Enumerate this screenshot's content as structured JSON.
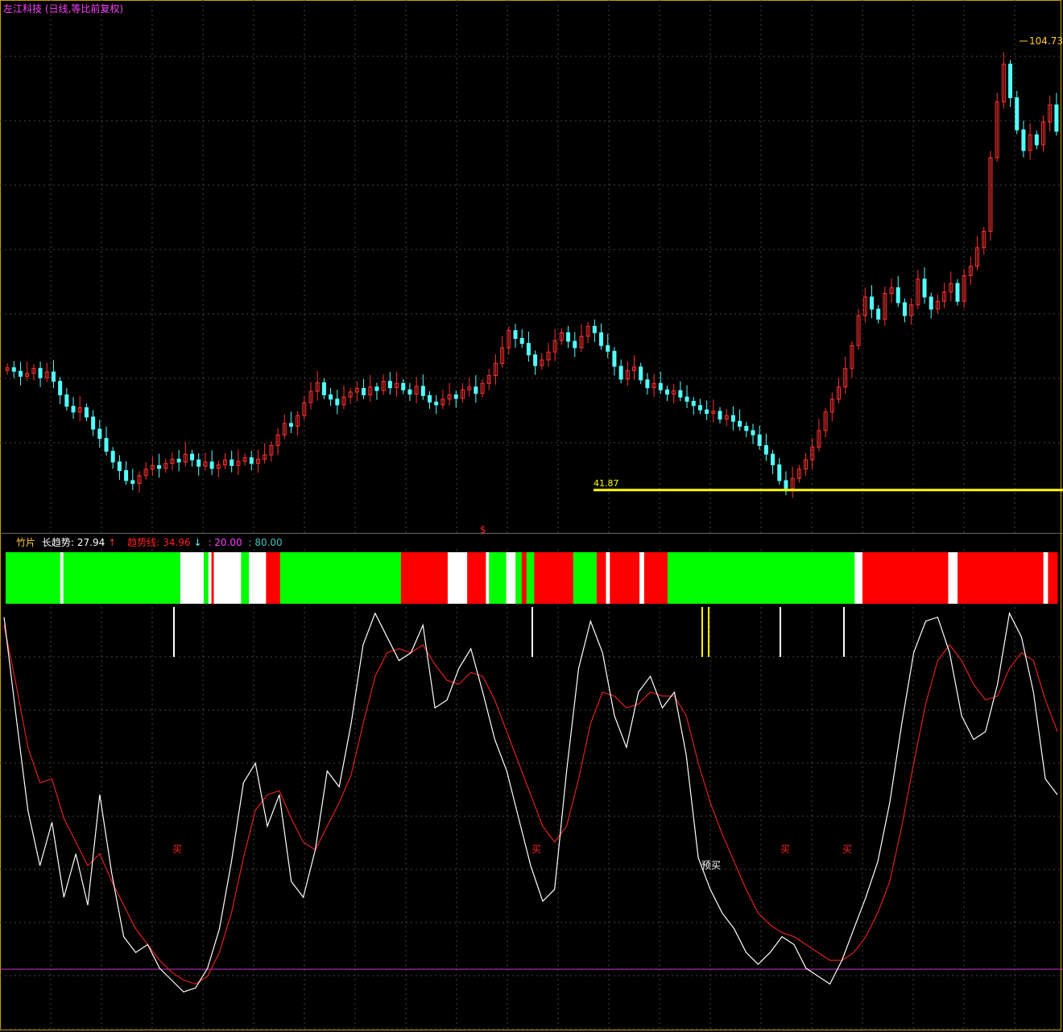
{
  "header": {
    "stock_name": "左江科技",
    "period_label": "(日线,等比前复权)"
  },
  "price_panel": {
    "high_label": "104.73",
    "low_line_label": "41.87",
    "marker_symbol": "$"
  },
  "indicator_panel": {
    "name": "竹片",
    "long_trend_label": "长趋势:",
    "long_trend_value": "27.94",
    "long_trend_arrow": "↑",
    "trend_line_label": "趋势线:",
    "trend_line_value": "34.96",
    "trend_line_arrow": "↓",
    "level_low": ": 20.00",
    "level_high": ": 80.00",
    "signal_buy": "买",
    "signal_prebuy": "预买"
  },
  "colors": {
    "frame": "#c8a000",
    "grid": "#444444",
    "up_candle": "#ff3030",
    "down_candle": "#54ffff",
    "support_line": "#ffff00",
    "band_green": "#00ff00",
    "band_red": "#ff0000",
    "band_white": "#ffffff",
    "fast_line": "#ffffff",
    "slow_line": "#e02020",
    "level_line": "#cc33cc",
    "high_label": "#ffcc33"
  },
  "chart_data": [
    {
      "type": "candlestick",
      "title": "左江科技 (日线,等比前复权)",
      "ylim": [
        37,
        108
      ],
      "annotations": [
        {
          "label": "104.73",
          "value": 104.73,
          "kind": "period-high"
        },
        {
          "label": "41.87",
          "value": 41.87,
          "kind": "support-line"
        }
      ],
      "close_series": [
        59,
        58.5,
        57.8,
        58.2,
        58.9,
        57.6,
        58.4,
        57.1,
        55.2,
        53.6,
        52.8,
        53.4,
        52.1,
        50.4,
        49.1,
        47.3,
        45.8,
        44.6,
        43.2,
        42.8,
        43.9,
        44.8,
        45.3,
        44.9,
        45.6,
        46.2,
        45.8,
        46.9,
        46.1,
        45.2,
        45.8,
        44.9,
        45.4,
        46.1,
        45.3,
        45.9,
        46.4,
        45.6,
        46.2,
        46.8,
        48.1,
        49.6,
        51.2,
        50.8,
        52.3,
        54.1,
        55.7,
        56.9,
        55.2,
        54.6,
        53.8,
        54.9,
        55.6,
        56.1,
        55.2,
        56.3,
        55.8,
        57.1,
        56.2,
        56.8,
        55.9,
        55.3,
        56.4,
        55.1,
        54.2,
        53.8,
        54.6,
        55.2,
        54.7,
        55.9,
        56.3,
        55.4,
        56.8,
        57.9,
        59.6,
        61.8,
        64.2,
        63.1,
        62.4,
        60.8,
        59.3,
        60.1,
        61.2,
        62.8,
        63.9,
        62.7,
        61.8,
        63.4,
        64.8,
        63.9,
        62.1,
        61.3,
        59.2,
        57.4,
        58.6,
        59.1,
        57.3,
        56.2,
        56.8,
        55.9,
        55.3,
        55.8,
        54.9,
        54.3,
        53.7,
        53.1,
        52.6,
        52.9,
        51.8,
        52.3,
        51.5,
        50.8,
        50.2,
        49.6,
        48.1,
        46.9,
        45.4,
        43.2,
        42.1,
        43.5,
        44.8,
        46.1,
        47.9,
        50.2,
        52.8,
        54.6,
        56.3,
        58.9,
        62.1,
        66.3,
        68.9,
        67.2,
        65.8,
        69.4,
        70.2,
        68.1,
        66.3,
        67.8,
        71.4,
        68.9,
        67.2,
        68.3,
        69.6,
        70.8,
        68.3,
        71.9,
        73.2,
        75.8,
        78.1,
        88.4,
        96.2,
        101.5,
        96.8,
        92.3,
        89.4,
        91.6,
        90.2,
        93.4,
        95.8,
        92.1
      ]
    },
    {
      "type": "line",
      "title": "竹片",
      "ylim": [
        0,
        100
      ],
      "reference_lines": [
        20,
        80
      ],
      "values_shown": {
        "长趋势": 27.94,
        "趋势线": 34.96
      },
      "band_sequence": [
        "green",
        "white",
        "green",
        "white",
        "green",
        "white",
        "red",
        "white",
        "green",
        "white",
        "red",
        "green",
        "red",
        "white",
        "red",
        "white",
        "green",
        "white",
        "green",
        "red",
        "green",
        "red",
        "green",
        "red",
        "white",
        "red",
        "white",
        "red",
        "green",
        "white",
        "red",
        "white",
        "red",
        "white",
        "red"
      ],
      "series": [
        {
          "name": "长趋势",
          "values": [
            97,
            72,
            48,
            34,
            45,
            26,
            37,
            24,
            52,
            32,
            16,
            12,
            14,
            8,
            5,
            2,
            3,
            8,
            18,
            35,
            55,
            60,
            44,
            52,
            30,
            26,
            38,
            58,
            54,
            70,
            90,
            98,
            92,
            86,
            88,
            95,
            74,
            76,
            84,
            89,
            78,
            66,
            58,
            46,
            34,
            25,
            28,
            58,
            84,
            96,
            88,
            72,
            64,
            78,
            82,
            74,
            78,
            62,
            36,
            28,
            22,
            18,
            12,
            9,
            12,
            16,
            14,
            8,
            6,
            4,
            10,
            18,
            26,
            35,
            50,
            70,
            88,
            96,
            97,
            88,
            72,
            66,
            68,
            80,
            98,
            92,
            78,
            56,
            52
          ]
        },
        {
          "name": "趋势线",
          "values": [
            95,
            80,
            64,
            55,
            56,
            46,
            40,
            34,
            37,
            30,
            24,
            18,
            14,
            10,
            7,
            5,
            4,
            6,
            12,
            22,
            36,
            48,
            52,
            53,
            46,
            40,
            38,
            44,
            50,
            57,
            70,
            82,
            88,
            89,
            88,
            90,
            85,
            81,
            80,
            83,
            82,
            76,
            68,
            60,
            52,
            44,
            40,
            44,
            56,
            70,
            78,
            77,
            74,
            75,
            78,
            77,
            77,
            72,
            60,
            50,
            42,
            35,
            28,
            22,
            19,
            17,
            16,
            14,
            12,
            10,
            10,
            12,
            16,
            22,
            30,
            44,
            60,
            75,
            86,
            90,
            86,
            80,
            76,
            77,
            84,
            88,
            86,
            76,
            68
          ]
        }
      ]
    }
  ]
}
